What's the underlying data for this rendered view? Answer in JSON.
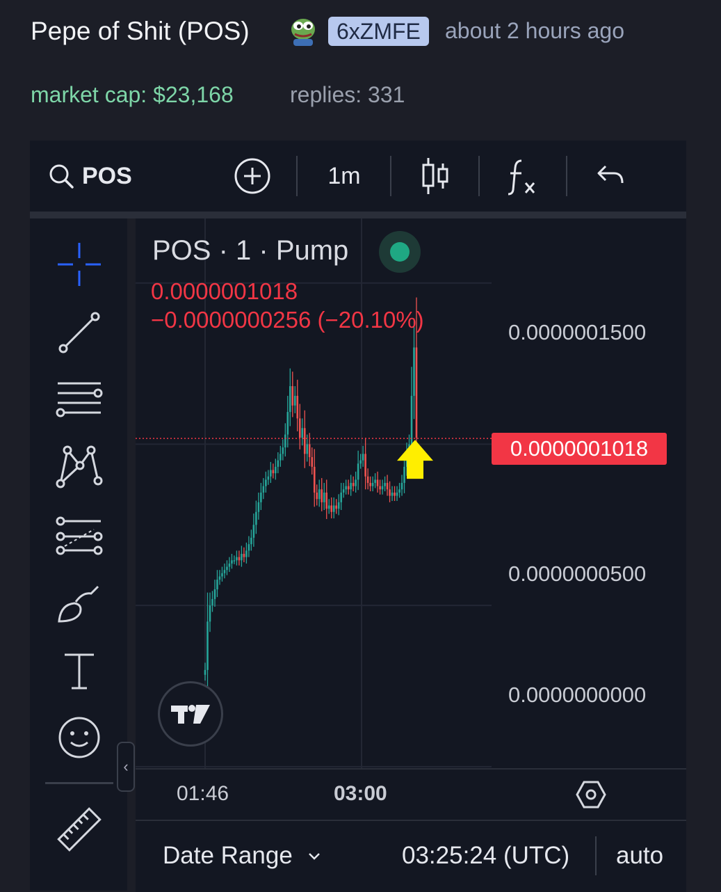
{
  "token": {
    "name": "Pepe of Shit (POS)",
    "ticker_badge": "6xZMFE",
    "age": "about 2 hours ago",
    "market_cap": "market cap: $23,168",
    "replies": "replies: 331"
  },
  "toolbar": {
    "symbol": "POS",
    "interval": "1m"
  },
  "legend": {
    "title": "POS · 1 · Pump",
    "price": "0.0000001018",
    "change": "−0.0000000256 (−20.10%)"
  },
  "yaxis": {
    "ticks": [
      "0.0000001500",
      "0.0000000500",
      "0.0000000000"
    ],
    "last_price_tag": "0.0000001018"
  },
  "xaxis": {
    "ticks": [
      "01:46",
      "03:00"
    ]
  },
  "bottom": {
    "date_range": "Date Range",
    "clock": "03:25:24 (UTC)",
    "auto": "auto"
  },
  "colors": {
    "up": "#26a69a",
    "down": "#ef5350",
    "price_line": "#f23645",
    "arrow": "#ffee00",
    "active_tool": "#2962ff"
  },
  "chart_data": {
    "type": "candlestick",
    "y_unit": "price",
    "ylim": [
      -4.5e-10,
      1.7e-07
    ],
    "x_labels": [
      "01:46",
      "03:00"
    ],
    "close_series": [
      3e-08,
      4.5e-08,
      5e-08,
      5.2e-08,
      5.5e-08,
      5.8e-08,
      5.9e-08,
      6e-08,
      6.1e-08,
      6.2e-08,
      6.3e-08,
      6.4e-08,
      6.4e-08,
      6.5e-08,
      6.4e-08,
      6.6e-08,
      6.5e-08,
      6.7e-08,
      6.9e-08,
      7.1e-08,
      7.5e-08,
      7.9e-08,
      8.2e-08,
      8.5e-08,
      8.7e-08,
      8.9e-08,
      9e-08,
      9.2e-08,
      9.1e-08,
      9.3e-08,
      9.5e-08,
      9.7e-08,
      9.9e-08,
      1.03e-07,
      1.1e-07,
      1.18e-07,
      1.12e-07,
      1.15e-07,
      1.08e-07,
      1.02e-07,
      1.05e-07,
      9.7e-08,
      1e-07,
      9.6e-08,
      9.3e-08,
      8.5e-08,
      8.3e-08,
      8.6e-08,
      8.2e-08,
      8.5e-08,
      8e-08,
      8.1e-08,
      7.9e-08,
      8.1e-08,
      8e-08,
      8.2e-08,
      8.5e-08,
      8.6e-08,
      8.7e-08,
      8.6e-08,
      8.8e-08,
      8.7e-08,
      8.9e-08,
      9.4e-08,
      9.5e-08,
      9.7e-08,
      9e-08,
      8.8e-08,
      8.7e-08,
      8.8e-08,
      8.9e-08,
      8.7e-08,
      8.6e-08,
      8.7e-08,
      8.8e-08,
      8.6e-08,
      8.4e-08,
      8.5e-08,
      8.4e-08,
      8.5e-08,
      8.6e-08,
      8.8e-08,
      9.3e-08,
      9.7e-08,
      1e-07,
      1.15e-07,
      1.3e-07,
      1.02e-07
    ],
    "last_price": 1.018e-07,
    "gridlines": true
  }
}
